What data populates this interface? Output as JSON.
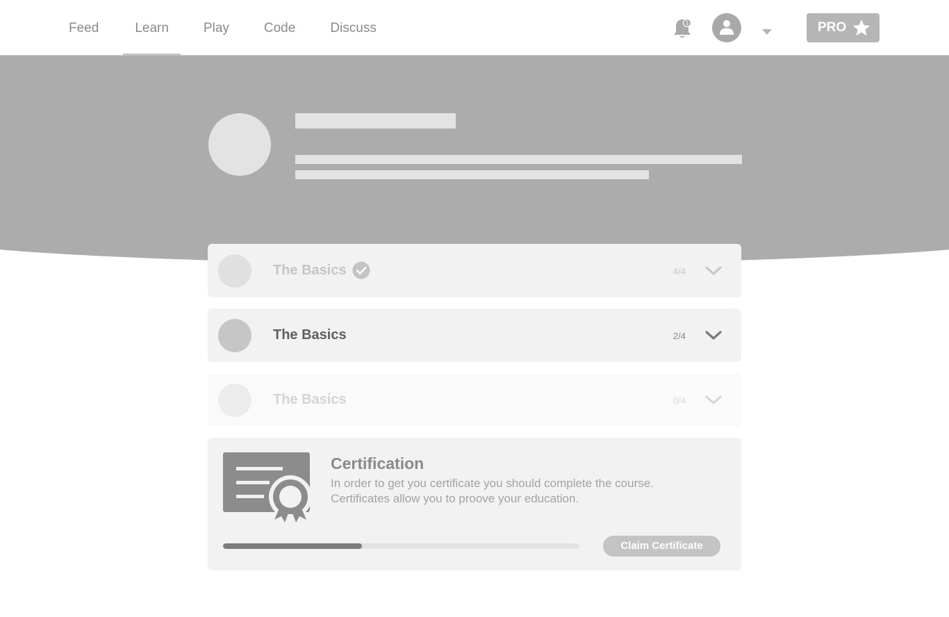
{
  "nav": {
    "items": [
      {
        "label": "Feed"
      },
      {
        "label": "Learn",
        "active": true
      },
      {
        "label": "Play"
      },
      {
        "label": "Code"
      },
      {
        "label": "Discuss"
      }
    ],
    "notification_count": "1",
    "pro_label": "PRO"
  },
  "modules": [
    {
      "title": "The Basics",
      "progress": "4/4",
      "state": "completed"
    },
    {
      "title": "The Basics",
      "progress": "2/4",
      "state": "in-progress"
    },
    {
      "title": "The Basics",
      "progress": "0/4",
      "state": "locked"
    }
  ],
  "certification": {
    "title": "Certification",
    "description_line1": "In order to get you certificate you should complete the course.",
    "description_line2": "Certificates allow you to proove your education.",
    "progress_fraction": 0.39,
    "claim_label": "Claim Certificate"
  },
  "colors": {
    "hero": "#acacac",
    "card": "#f2f2f2",
    "accent_dark": "#7d7d7d"
  }
}
